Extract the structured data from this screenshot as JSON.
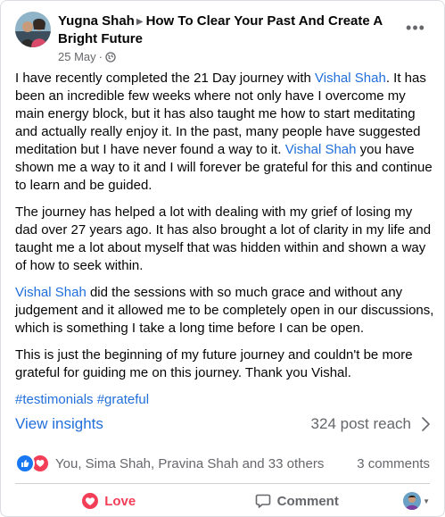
{
  "post": {
    "author": "Yugna Shah",
    "shared_to": "How To Clear Your Past And Create A Bright Future",
    "date": "25 May",
    "separator": "·",
    "more": "•••"
  },
  "content": {
    "p1": {
      "t1": "I have recently completed the 21 Day journey with ",
      "mention1": "Vishal Shah",
      "t2": ". It has been an incredible few weeks where not only have I overcome my main energy block, but it has also taught me how to start meditating and actually really enjoy it. In the past, many people have suggested meditation but I have never found a way to it. ",
      "mention2": "Vishal Shah",
      "t3": " you have shown me a way to it and I will forever be grateful for this and continue to learn and be guided."
    },
    "p2": "The journey has helped a lot with dealing with my grief of losing my dad over 27 years ago. It has also brought a lot of clarity in my life and taught me a lot about myself that was hidden within and shown a way of how to seek within.",
    "p3": {
      "mention": "Vishal Shah",
      "text": " did the sessions with so much grace and without any judgement and it allowed me to be completely open in our discussions, which is something I take a long time before I can be open."
    },
    "p4": "This is just the beginning of my future journey and couldn't be more grateful for guiding me on this journey. Thank you Vishal.",
    "hashtags": [
      "#testimonials",
      "#grateful"
    ]
  },
  "insights": {
    "link": "View insights",
    "reach": "324 post reach"
  },
  "reactions": {
    "summary": "You, Sima Shah, Pravina Shah and 33 others",
    "comments": "3 comments"
  },
  "actions": {
    "love": "Love",
    "comment": "Comment"
  },
  "colors": {
    "link": "#216fdb",
    "love": "#f33e58",
    "like": "#1877f2",
    "muted": "#65676b"
  }
}
